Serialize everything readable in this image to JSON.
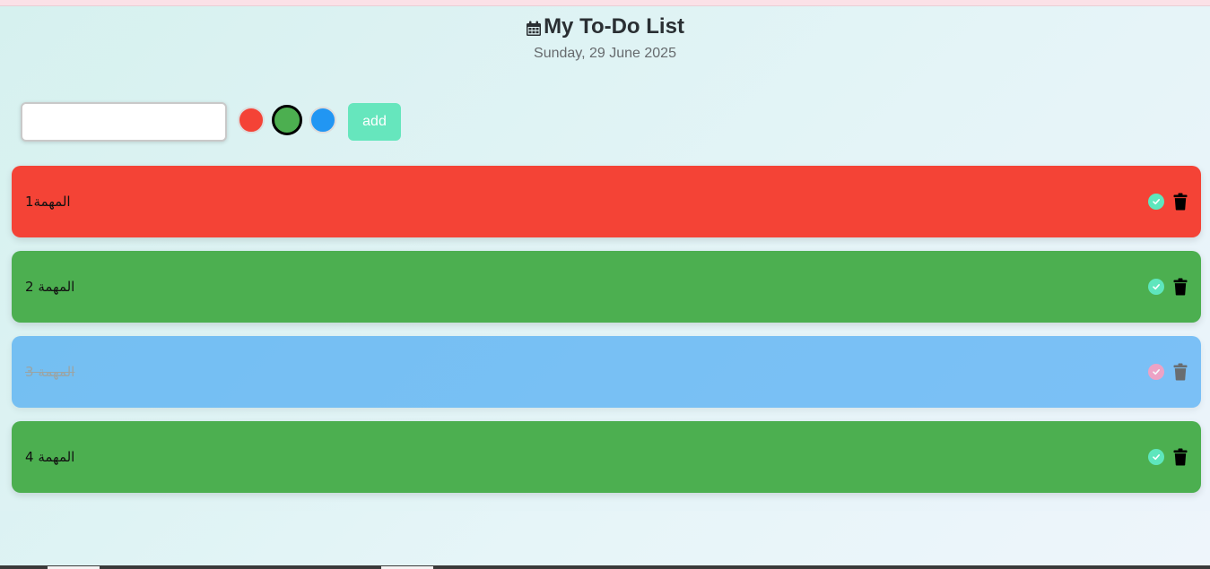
{
  "header": {
    "title": "My To-Do List",
    "date": "Sunday, 29 June 2025",
    "icon": "calendar-icon"
  },
  "form": {
    "input_value": "",
    "add_label": "add",
    "colors": [
      {
        "name": "red",
        "hex": "#f44336",
        "selected": false
      },
      {
        "name": "green",
        "hex": "#4caf50",
        "selected": true
      },
      {
        "name": "blue",
        "hex": "#2196f3",
        "selected": false
      }
    ]
  },
  "tasks": [
    {
      "text": "المهمة1",
      "color": "#f44336",
      "done": false
    },
    {
      "text": "المهمة 2",
      "color": "#4caf50",
      "done": false
    },
    {
      "text": "المهمة 3",
      "color": "#2196f3",
      "done": true
    },
    {
      "text": "المهمة 4",
      "color": "#4caf50",
      "done": false
    }
  ],
  "colors": {
    "accent": "#66e6bd",
    "check_active": "#5ee6bd",
    "check_done": "#f0609a"
  }
}
